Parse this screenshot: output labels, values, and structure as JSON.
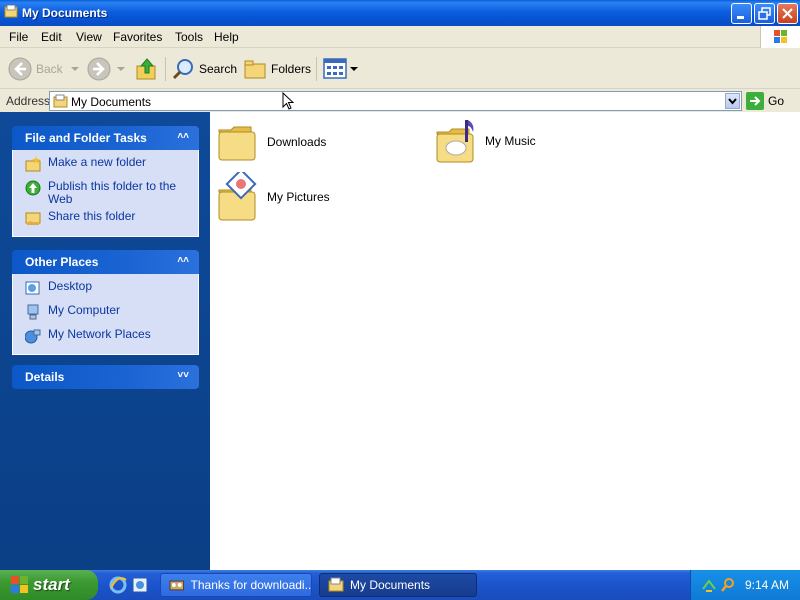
{
  "window": {
    "title": "My Documents",
    "controls": {
      "minimize": "minimize",
      "maximize": "maximize",
      "close": "close"
    }
  },
  "menubar": {
    "items": [
      "File",
      "Edit",
      "View",
      "Favorites",
      "Tools",
      "Help"
    ]
  },
  "toolbar": {
    "back_label": "Back",
    "search_label": "Search",
    "folders_label": "Folders"
  },
  "addressbar": {
    "label": "Address",
    "value": "My Documents",
    "go_label": "Go"
  },
  "leftpane": {
    "file_tasks": {
      "title": "File and Folder Tasks",
      "items": [
        "Make a new folder",
        "Publish this folder to the Web",
        "Share this folder"
      ]
    },
    "other_places": {
      "title": "Other Places",
      "items": [
        "Desktop",
        "My Computer",
        "My Network Places"
      ]
    },
    "details": {
      "title": "Details"
    }
  },
  "content": {
    "items": [
      "Downloads",
      "My Music",
      "My Pictures"
    ]
  },
  "taskbar": {
    "start_label": "start",
    "tasks": [
      "Thanks for downloadi...",
      "My Documents"
    ],
    "clock": "9:14 AM"
  },
  "colors": {
    "titlebar": "#0a5fd8",
    "leftpane": "#0e4a99",
    "panel_body": "#d6dff5",
    "link": "#0c36a0",
    "start_green": "#3c9a32"
  }
}
